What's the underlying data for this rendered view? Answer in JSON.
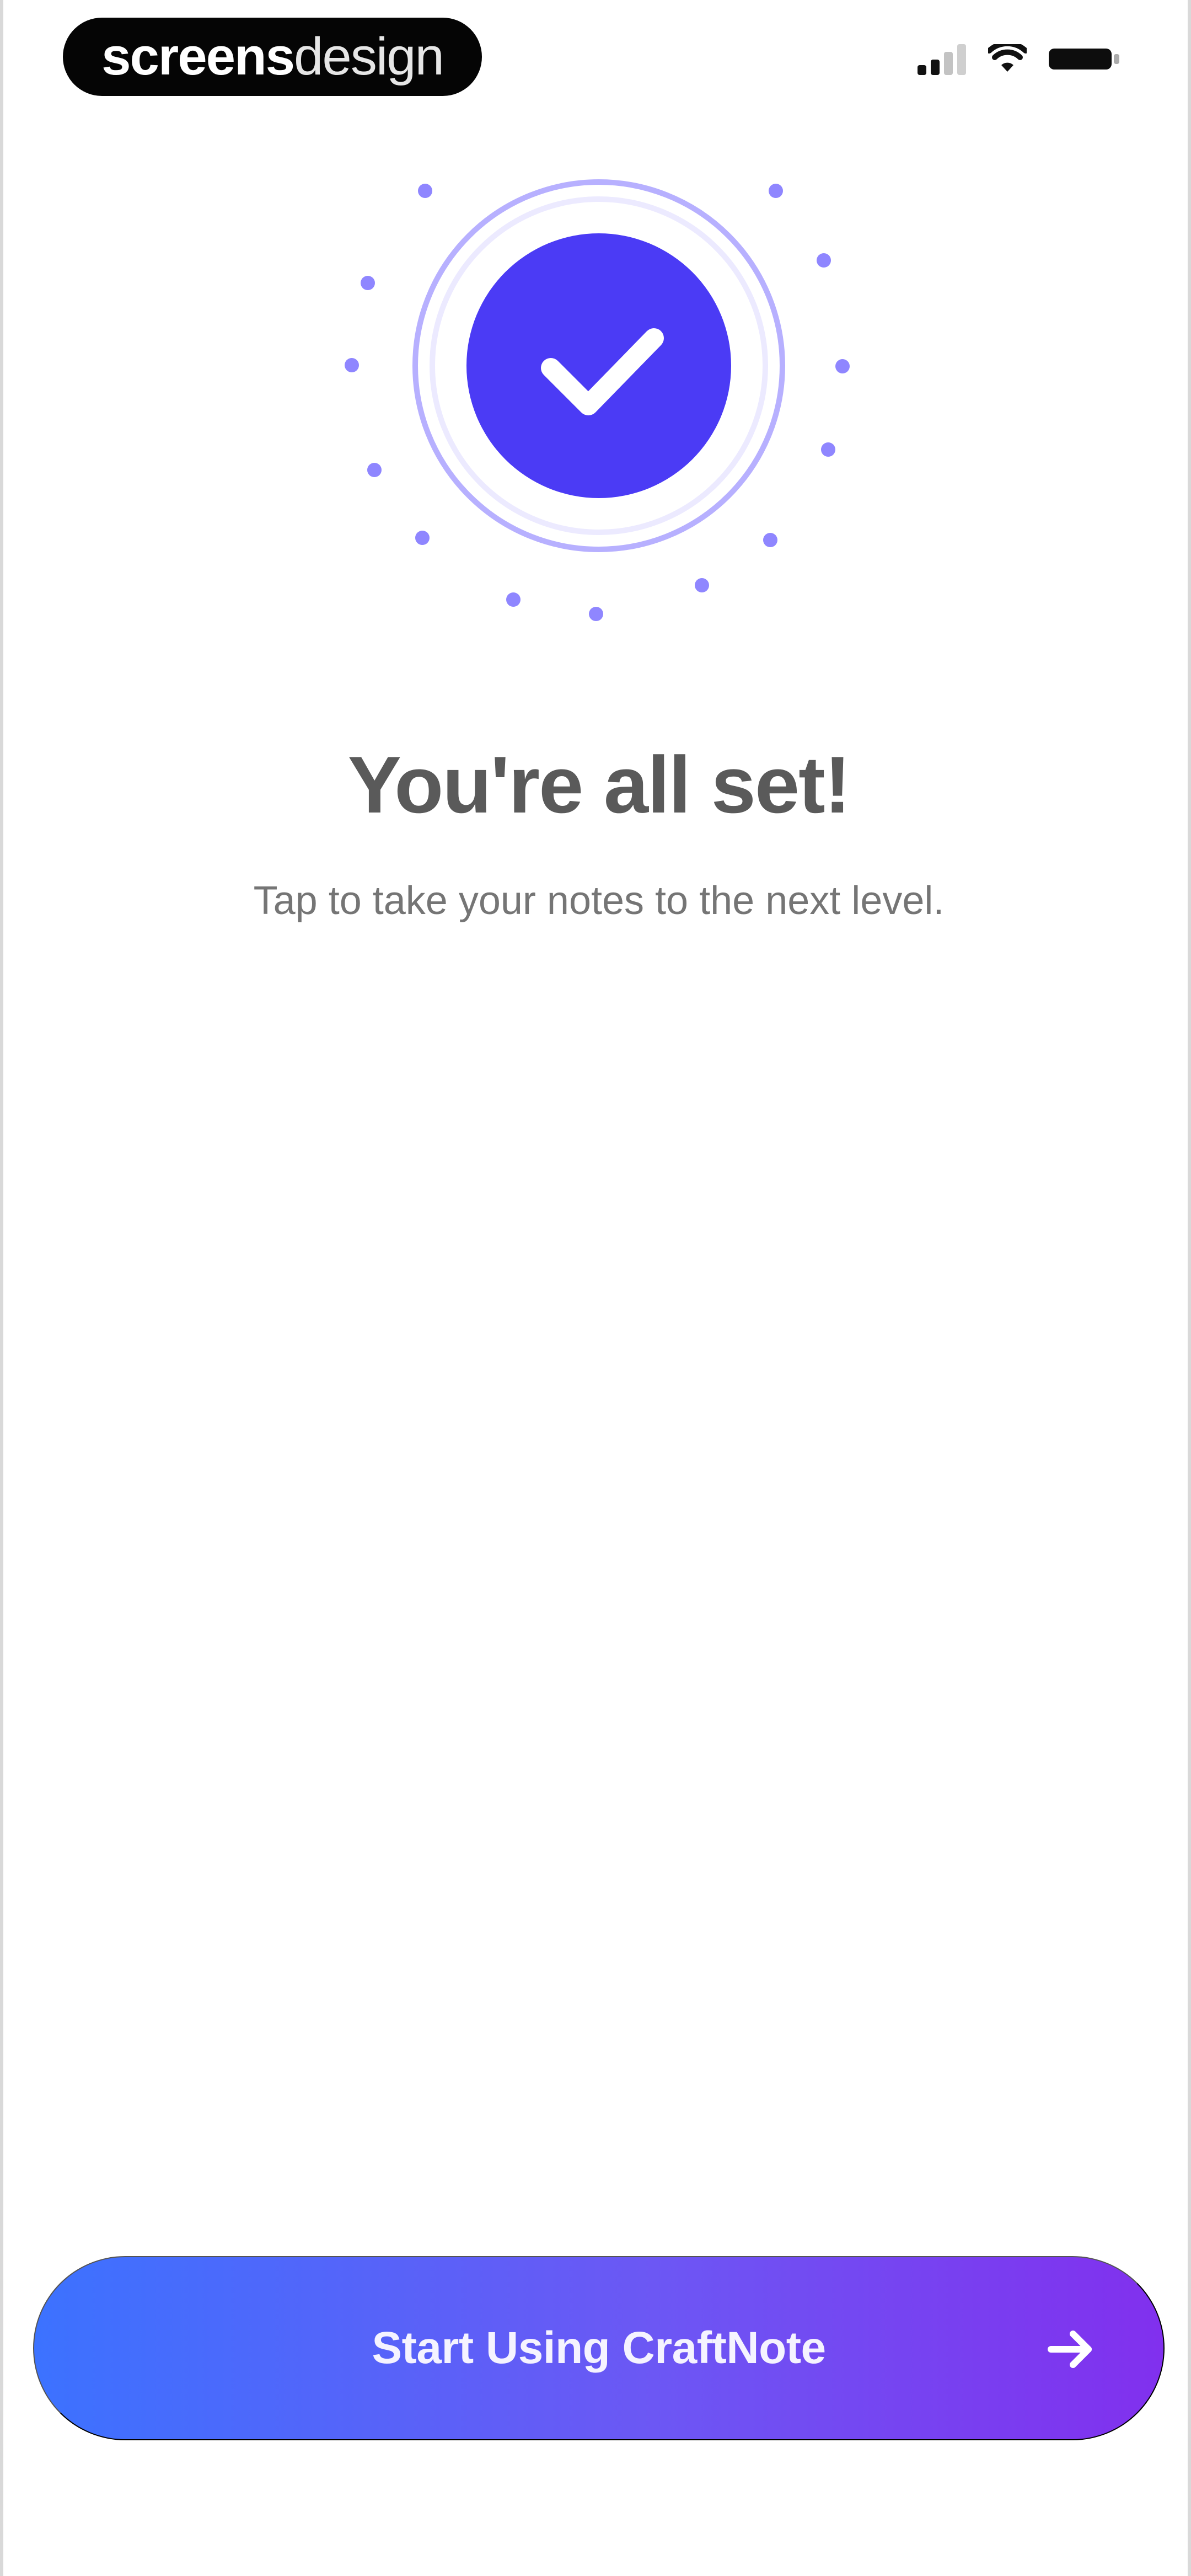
{
  "app": {
    "brand_bold": "screens",
    "brand_light": "design"
  },
  "status_bar": {
    "signal_icon": "signal-icon",
    "wifi_icon": "wifi-icon",
    "battery_icon": "battery-icon"
  },
  "success": {
    "icon": "check-icon",
    "title": "You're all set!",
    "subtitle": "Tap to take your notes to the next level."
  },
  "cta": {
    "label": "Start Using CraftNote",
    "icon": "arrow-right-icon"
  },
  "colors": {
    "accent": "#4b3bf5",
    "ring": "#b9b2ff",
    "dots": "#8f86ff",
    "gradient_start": "#3c72ff",
    "gradient_end": "#8130ee"
  }
}
